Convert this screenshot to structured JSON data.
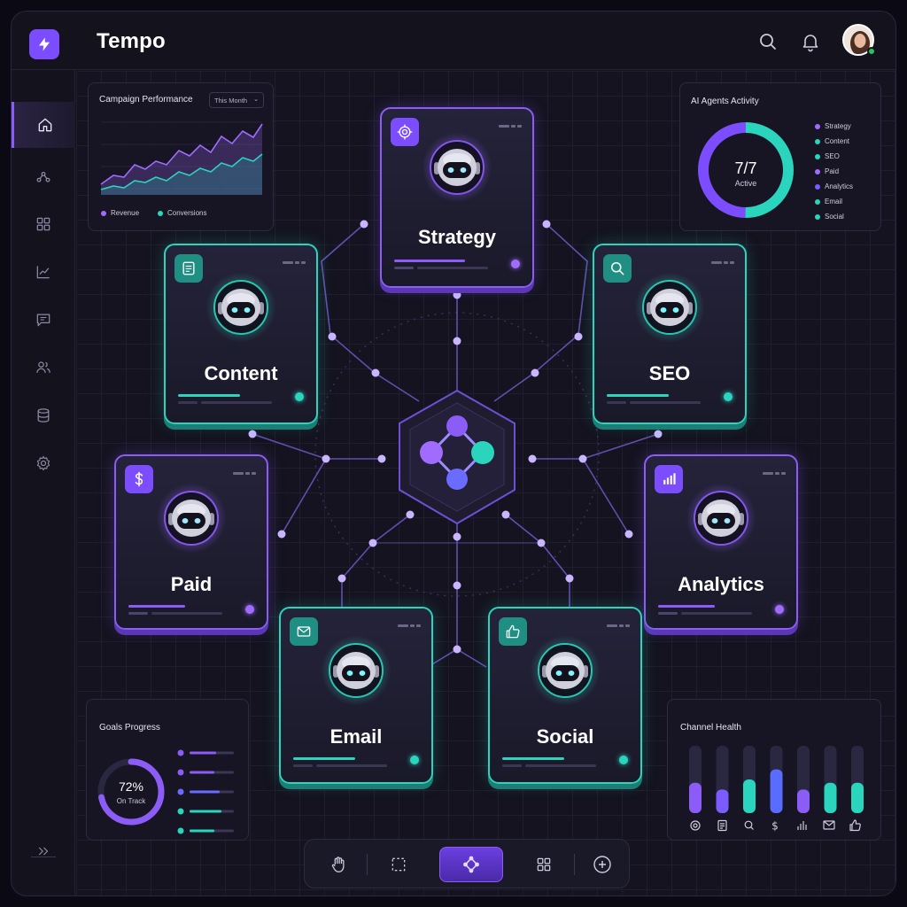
{
  "app": {
    "title": "Tempo"
  },
  "campaign_panel": {
    "title": "Campaign Performance",
    "filter": "This Month",
    "legend": [
      {
        "label": "Revenue",
        "color": "#a06bff"
      },
      {
        "label": "Conversions",
        "color": "#2bd4bd"
      }
    ]
  },
  "agents_panel": {
    "title": "AI Agents Activity",
    "count": "7/7",
    "count_label": "Active",
    "legend": [
      {
        "label": "Strategy",
        "color": "#a06bff"
      },
      {
        "label": "Content",
        "color": "#2bd4bd"
      },
      {
        "label": "SEO",
        "color": "#2bd4bd"
      },
      {
        "label": "Paid",
        "color": "#a06bff"
      },
      {
        "label": "Analytics",
        "color": "#7c5cff"
      },
      {
        "label": "Email",
        "color": "#2bd4bd"
      },
      {
        "label": "Social",
        "color": "#2bd4bd"
      }
    ]
  },
  "agents": [
    {
      "id": "strategy",
      "label": "Strategy",
      "theme": "violet",
      "icon": "target-icon"
    },
    {
      "id": "content",
      "label": "Content",
      "theme": "teal",
      "icon": "document-icon"
    },
    {
      "id": "seo",
      "label": "SEO",
      "theme": "teal",
      "icon": "search-icon"
    },
    {
      "id": "paid",
      "label": "Paid",
      "theme": "violet",
      "icon": "dollar-icon"
    },
    {
      "id": "analytics",
      "label": "Analytics",
      "theme": "violet",
      "icon": "bar-chart-icon"
    },
    {
      "id": "email",
      "label": "Email",
      "theme": "teal",
      "icon": "mail-icon"
    },
    {
      "id": "social",
      "label": "Social",
      "theme": "teal",
      "icon": "thumbs-up-icon"
    }
  ],
  "goals_panel": {
    "title": "Goals Progress",
    "percent": "72%",
    "progress_fraction": 0.72,
    "status": "On Track"
  },
  "channel_panel": {
    "title": "Channel Health",
    "levels": [
      0.45,
      0.35,
      0.5,
      0.65,
      0.35,
      0.45,
      0.45
    ],
    "colors": [
      "#8b5cf6",
      "#7c5cff",
      "#2bd4bd",
      "#5a6bff",
      "#8b5cf6",
      "#2bd4bd",
      "#2bd4bd"
    ],
    "icons": [
      "target-icon",
      "document-icon",
      "search-icon",
      "dollar-icon",
      "bar-chart-icon",
      "mail-icon",
      "thumbs-up-icon"
    ]
  },
  "colors": {
    "accent_violet": "#8b5cf6",
    "accent_teal": "#2bd4bd",
    "background": "#13121d"
  }
}
